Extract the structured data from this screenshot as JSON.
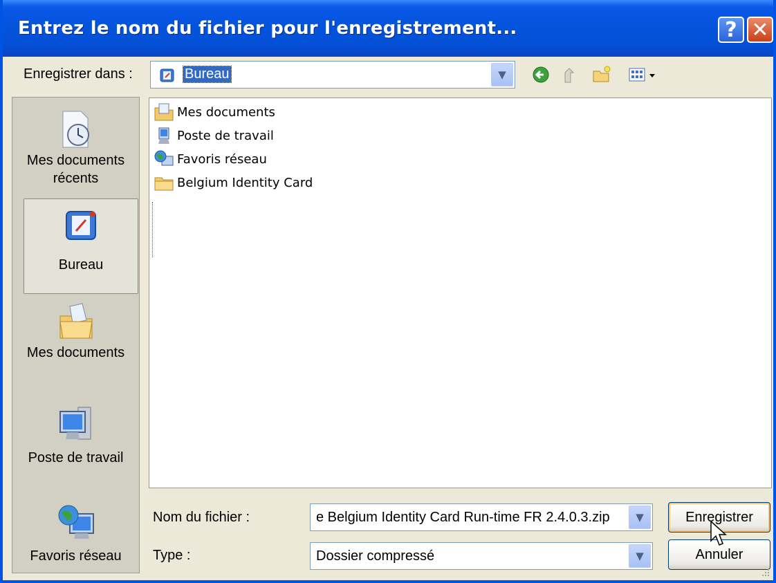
{
  "window": {
    "title": "Entrez le nom du fichier pour l'enregistrement...",
    "help_label": "?",
    "close_label": "✕",
    "accent_color": "#0054E3"
  },
  "location": {
    "label": "Enregistrer dans :",
    "value": "Bureau"
  },
  "toolbar": {
    "back_icon": "back-arrow-icon",
    "up_icon": "up-folder-icon",
    "new_folder_icon": "new-folder-icon",
    "views_icon": "views-menu-icon"
  },
  "places": [
    {
      "label_line1": "Mes documents",
      "label_line2": "récents",
      "icon": "recent-documents-icon"
    },
    {
      "label_line1": "Bureau",
      "icon": "desktop-icon",
      "selected": true
    },
    {
      "label_line1": "Mes documents",
      "icon": "my-documents-icon"
    },
    {
      "label_line1": "Poste de travail",
      "icon": "my-computer-icon"
    },
    {
      "label_line1": "Favoris réseau",
      "icon": "network-places-icon"
    }
  ],
  "files": [
    {
      "name": "Mes documents",
      "icon": "documents-folder-icon"
    },
    {
      "name": "Poste de travail",
      "icon": "computer-icon"
    },
    {
      "name": "Favoris réseau",
      "icon": "network-icon"
    },
    {
      "name": "Belgium Identity Card",
      "icon": "folder-icon"
    }
  ],
  "filename": {
    "label": "Nom du fichier :",
    "value": "e Belgium Identity Card Run-time FR 2.4.0.3.zip"
  },
  "filetype": {
    "label": "Type :",
    "value": "Dossier compressé"
  },
  "buttons": {
    "save": "Enregistrer",
    "cancel": "Annuler"
  }
}
